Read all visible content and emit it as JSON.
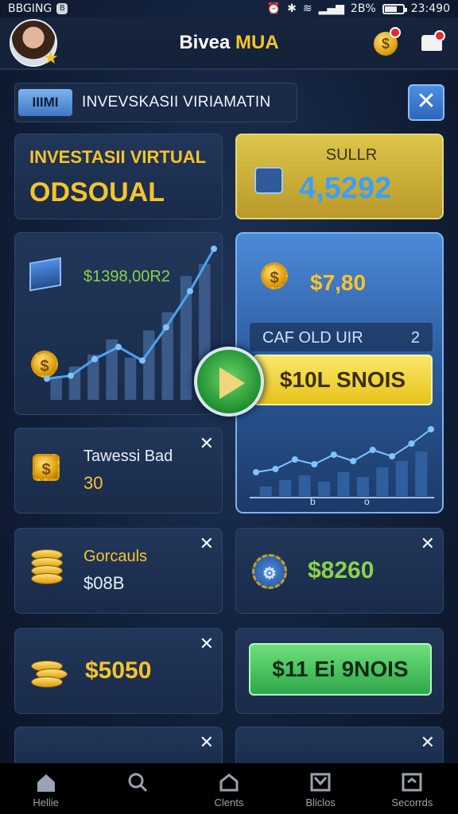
{
  "status_bar": {
    "left_text": "BBGING",
    "right_battery": "2B%",
    "time": "23:490",
    "battery_level": 0.7
  },
  "header": {
    "title_main": "Bivea",
    "title_accent": "MUA"
  },
  "tabs": {
    "pill_label": "IIIMI",
    "title": "INVEVSKASII VIRIAMATIN"
  },
  "cards": {
    "hero": {
      "line1": "INVESTASII VIRTUAL",
      "line2": "ODSOUAL"
    },
    "sulr": {
      "label": "SULLR",
      "value": "4,5292"
    },
    "chart1": {
      "value": "$1398,00R2"
    },
    "panel2": {
      "value": "$7,80",
      "row_left": "CAF OLD UIR",
      "row_right": "2",
      "bonus_label": "$10L SNOIS",
      "tick_labels": [
        "b",
        "o"
      ]
    },
    "c1": {
      "title": "Tawessi Bad",
      "amount": "30"
    },
    "c2": {
      "title": "Gorcauls",
      "amount": "$08B"
    },
    "c3": {
      "amount": "$8260"
    },
    "c4": {
      "amount": "$5050"
    },
    "c5": {
      "bonus_label": "$11 Ei 9NOIS"
    }
  },
  "chart_series": {
    "chart1_line": [
      14,
      16,
      27,
      35,
      26,
      48,
      72,
      100
    ],
    "chart1_bars": [
      15,
      22,
      30,
      40,
      28,
      46,
      58,
      82,
      90
    ],
    "panel2_line": [
      30,
      34,
      46,
      40,
      52,
      44,
      58,
      50,
      66,
      84
    ],
    "panel2_bars": [
      12,
      20,
      26,
      18,
      30,
      24,
      36,
      44,
      56
    ]
  },
  "bottom_nav": [
    {
      "label": "Hellie",
      "icon": "home-icon"
    },
    {
      "label": "",
      "icon": "search-icon"
    },
    {
      "label": "Clents",
      "icon": "clients-icon"
    },
    {
      "label": "Bliclos",
      "icon": "checklist-icon"
    },
    {
      "label": "Secorrds",
      "icon": "records-icon"
    }
  ],
  "colors": {
    "accent_gold": "#f6c42a",
    "accent_green": "#8ad24b",
    "accent_blue": "#3aa0f5"
  }
}
